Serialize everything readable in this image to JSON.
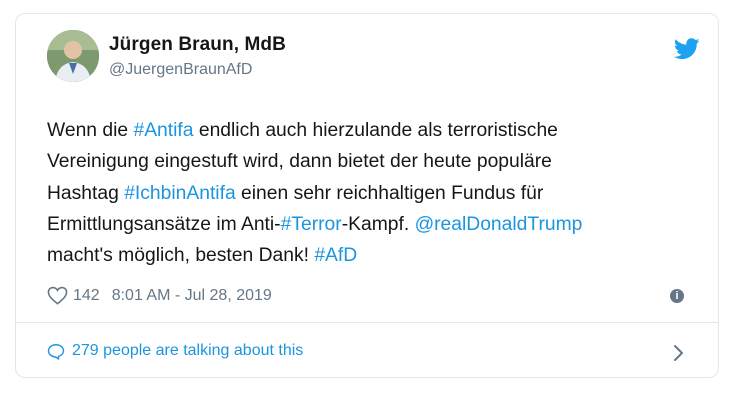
{
  "tweet": {
    "author_name": "Jürgen Braun, MdB",
    "author_handle": "@JuergenBraunAfD",
    "text_segments": [
      [
        "Wenn die ",
        "#Antifa",
        " endlich auch hierzulande als terroristische"
      ],
      [
        "Vereinigung eingestuft wird, dann bietet der heute populäre"
      ],
      [
        "Hashtag ",
        "#IchbinAntifa",
        " einen sehr reichhaltigen Fundus für"
      ],
      [
        "Ermittlungsansätze im Anti-",
        "#Terror",
        "-Kampf. ",
        "@realDonaldTrump"
      ],
      [
        "macht's möglich, besten Dank! ",
        "#AfD"
      ]
    ],
    "likes": "142",
    "timestamp": "8:01 AM - Jul 28, 2019",
    "talking": "279 people are talking about this"
  },
  "colors": {
    "link": "#1b95e0",
    "muted": "#657786",
    "border": "#e1e8ed"
  },
  "icons": [
    "twitter-bird-icon",
    "heart-icon",
    "info-icon",
    "comment-bubble-icon",
    "chevron-right-icon"
  ]
}
